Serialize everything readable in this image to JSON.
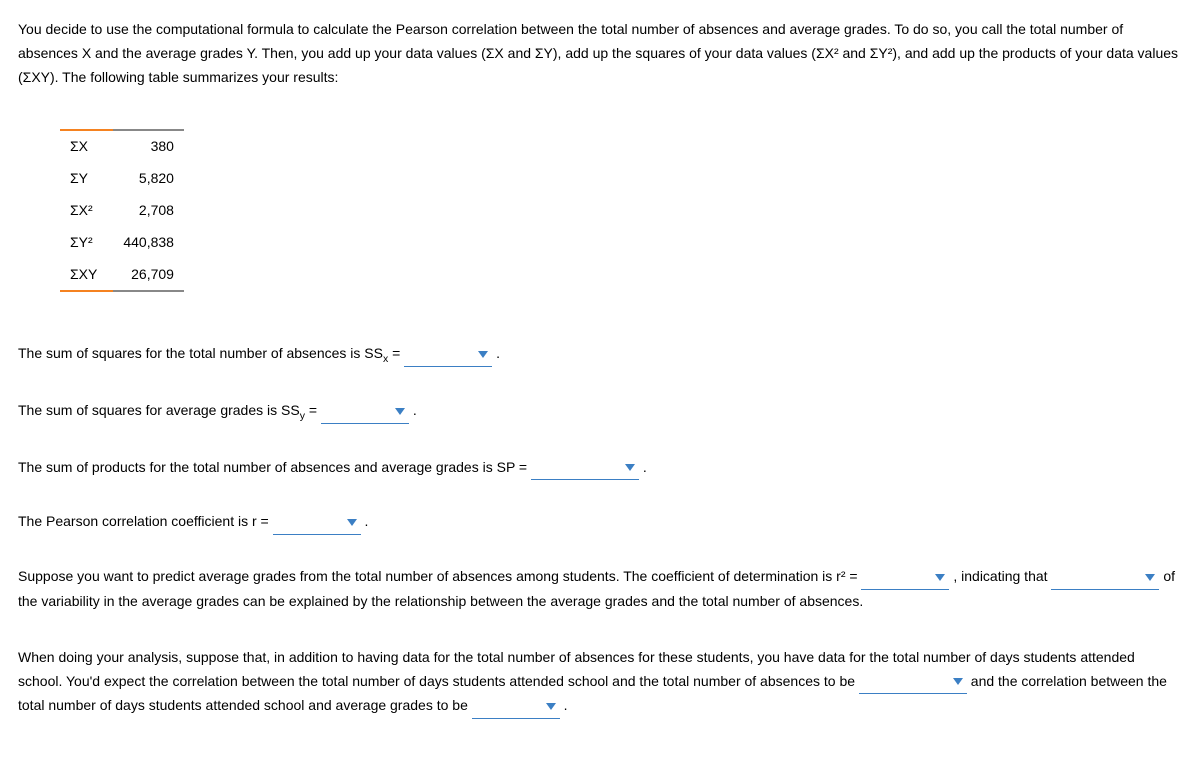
{
  "intro": "You decide to use the computational formula to calculate the Pearson correlation between the total number of absences and average grades. To do so, you call the total number of absences X and the average grades Y. Then, you add up your data values (ΣX and ΣY), add up the squares of your data values (ΣX² and ΣY²), and add up the products of your data values (ΣXY). The following table summarizes your results:",
  "table": {
    "rows": [
      {
        "label": "ΣX",
        "value": "380"
      },
      {
        "label": "ΣY",
        "value": "5,820"
      },
      {
        "label": "ΣX²",
        "value": "2,708"
      },
      {
        "label": "ΣY²",
        "value": "440,838"
      },
      {
        "label": "ΣXY",
        "value": "26,709"
      }
    ]
  },
  "statements": {
    "ssx_pre": "The sum of squares for the total number of absences is SS",
    "ssx_sub": "x",
    "ssy_pre": "The sum of squares for average grades is SS",
    "ssy_sub": "y",
    "sp": "The sum of products for the total number of absences and average grades is SP =",
    "r": "The Pearson correlation coefficient is r =",
    "eq": " ="
  },
  "predict": {
    "p1": "Suppose you want to predict average grades from the total number of absences among students. The coefficient of determination is r² =",
    "p2": ", indicating that",
    "p3": "of the variability in the average grades can be explained by the relationship between the average grades and the total number of absences."
  },
  "analysis": {
    "p1": "When doing your analysis, suppose that, in addition to having data for the total number of absences for these students, you have data for the total number of days students attended school. You'd expect the correlation between the total number of days students attended school and the total number of absences to be",
    "p2": "and the correlation between the total number of days students attended school and average grades to be"
  },
  "period": "."
}
